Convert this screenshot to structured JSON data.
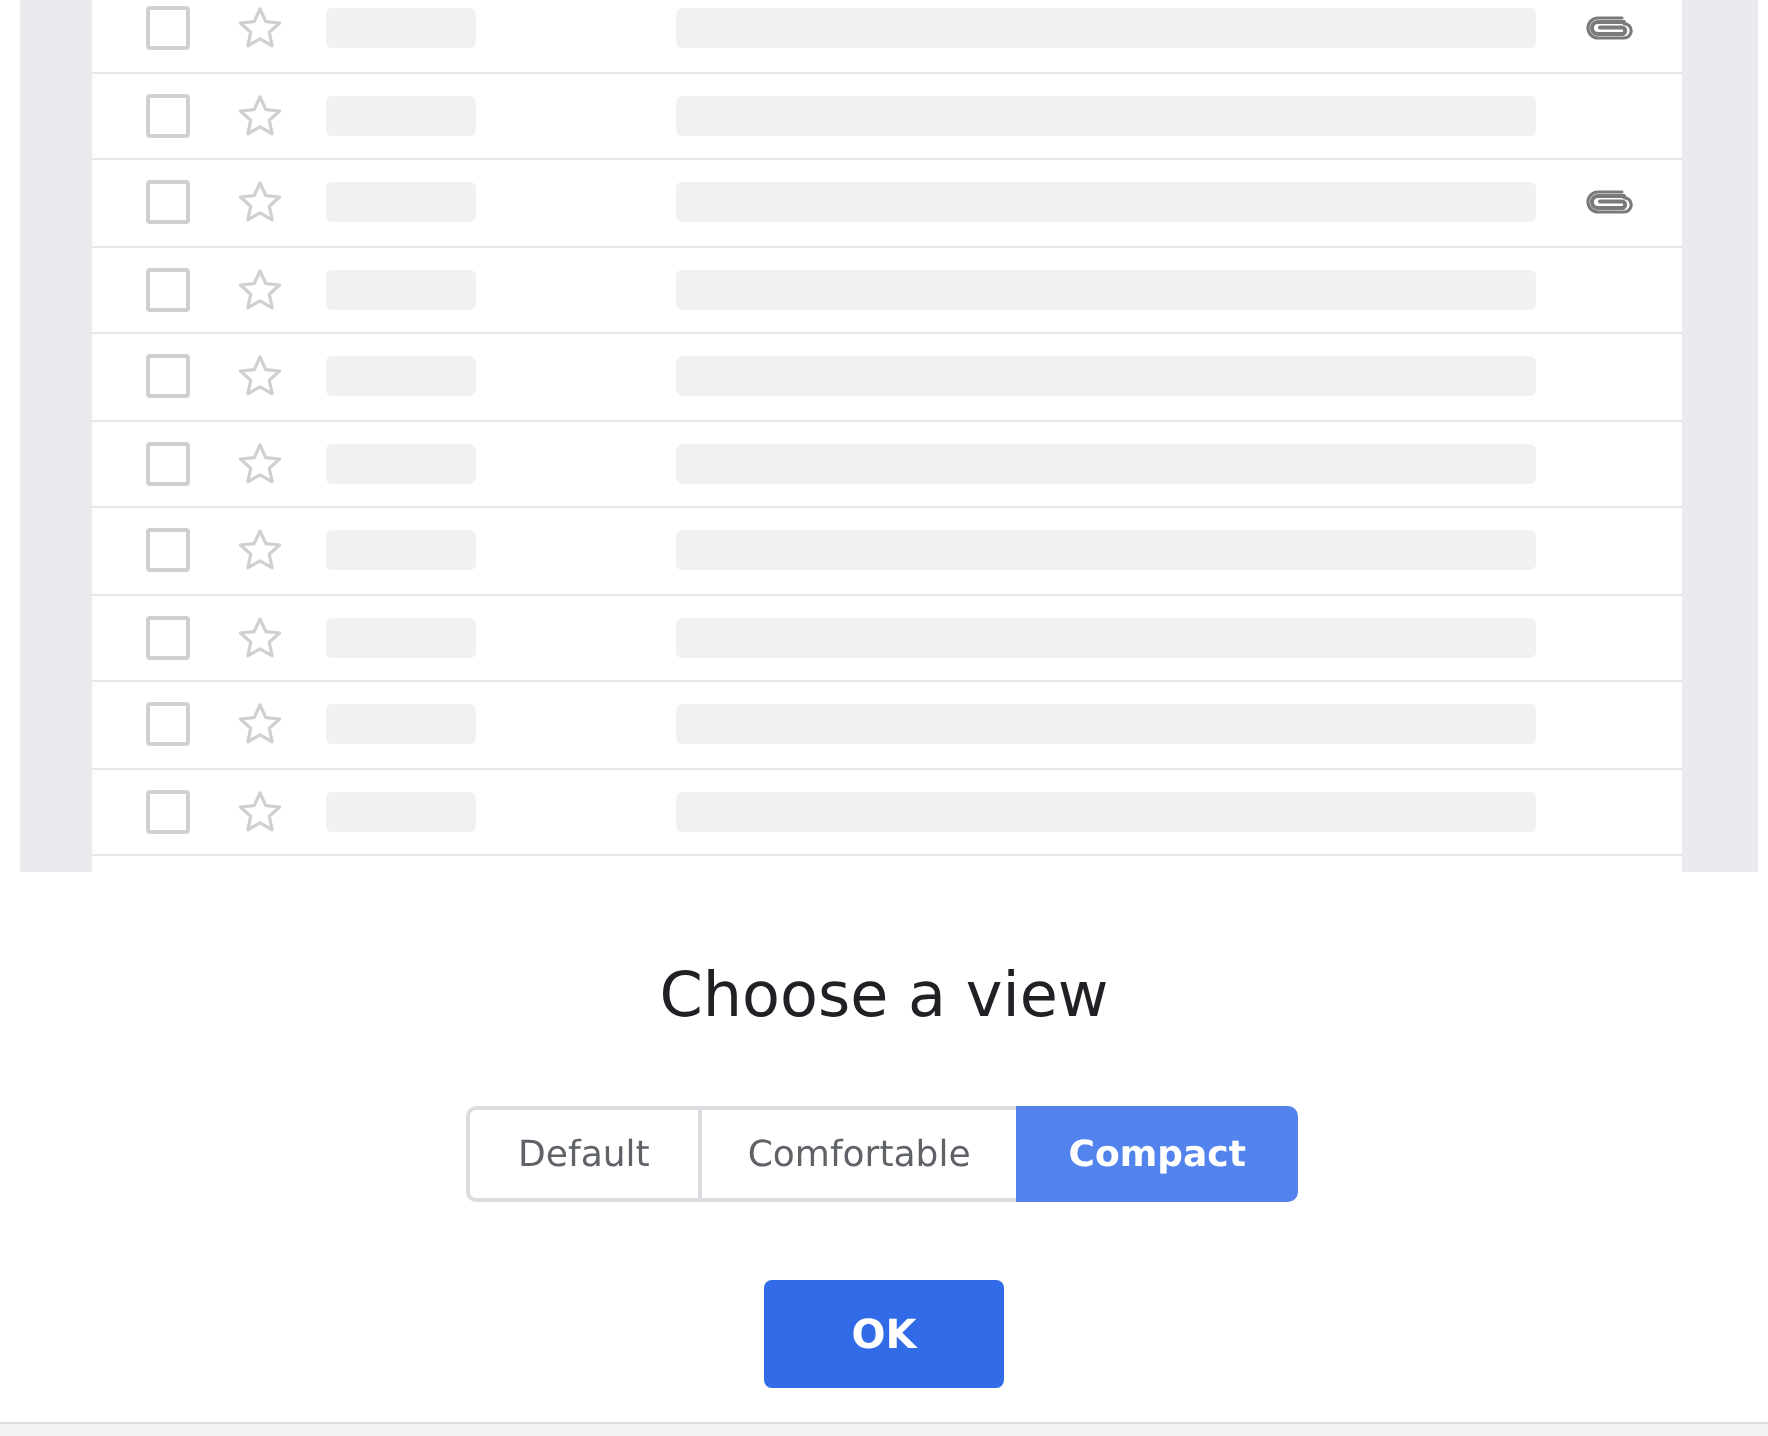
{
  "preview_rows": [
    {
      "checked": false,
      "starred": false,
      "attachment": true
    },
    {
      "checked": false,
      "starred": false,
      "attachment": false
    },
    {
      "checked": false,
      "starred": false,
      "attachment": true
    },
    {
      "checked": false,
      "starred": false,
      "attachment": false
    },
    {
      "checked": false,
      "starred": false,
      "attachment": false
    },
    {
      "checked": false,
      "starred": false,
      "attachment": false
    },
    {
      "checked": false,
      "starred": false,
      "attachment": false
    },
    {
      "checked": false,
      "starred": false,
      "attachment": false
    },
    {
      "checked": false,
      "starred": false,
      "attachment": false
    },
    {
      "checked": false,
      "starred": false,
      "attachment": false
    }
  ],
  "title": "Choose a view",
  "view_options": [
    {
      "label": "Default",
      "selected": false
    },
    {
      "label": "Comfortable",
      "selected": false
    },
    {
      "label": "Compact",
      "selected": true
    }
  ],
  "ok_button": "OK"
}
